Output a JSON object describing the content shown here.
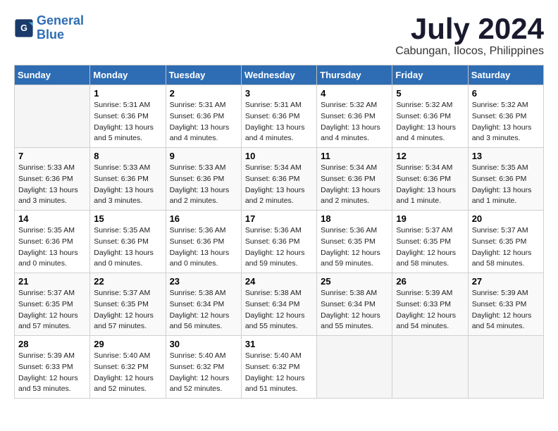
{
  "header": {
    "logo_line1": "General",
    "logo_line2": "Blue",
    "month_year": "July 2024",
    "location": "Cabungan, Ilocos, Philippines"
  },
  "weekdays": [
    "Sunday",
    "Monday",
    "Tuesday",
    "Wednesday",
    "Thursday",
    "Friday",
    "Saturday"
  ],
  "weeks": [
    [
      {
        "day": "",
        "info": ""
      },
      {
        "day": "1",
        "info": "Sunrise: 5:31 AM\nSunset: 6:36 PM\nDaylight: 13 hours\nand 5 minutes."
      },
      {
        "day": "2",
        "info": "Sunrise: 5:31 AM\nSunset: 6:36 PM\nDaylight: 13 hours\nand 4 minutes."
      },
      {
        "day": "3",
        "info": "Sunrise: 5:31 AM\nSunset: 6:36 PM\nDaylight: 13 hours\nand 4 minutes."
      },
      {
        "day": "4",
        "info": "Sunrise: 5:32 AM\nSunset: 6:36 PM\nDaylight: 13 hours\nand 4 minutes."
      },
      {
        "day": "5",
        "info": "Sunrise: 5:32 AM\nSunset: 6:36 PM\nDaylight: 13 hours\nand 4 minutes."
      },
      {
        "day": "6",
        "info": "Sunrise: 5:32 AM\nSunset: 6:36 PM\nDaylight: 13 hours\nand 3 minutes."
      }
    ],
    [
      {
        "day": "7",
        "info": "Sunrise: 5:33 AM\nSunset: 6:36 PM\nDaylight: 13 hours\nand 3 minutes."
      },
      {
        "day": "8",
        "info": "Sunrise: 5:33 AM\nSunset: 6:36 PM\nDaylight: 13 hours\nand 3 minutes."
      },
      {
        "day": "9",
        "info": "Sunrise: 5:33 AM\nSunset: 6:36 PM\nDaylight: 13 hours\nand 2 minutes."
      },
      {
        "day": "10",
        "info": "Sunrise: 5:34 AM\nSunset: 6:36 PM\nDaylight: 13 hours\nand 2 minutes."
      },
      {
        "day": "11",
        "info": "Sunrise: 5:34 AM\nSunset: 6:36 PM\nDaylight: 13 hours\nand 2 minutes."
      },
      {
        "day": "12",
        "info": "Sunrise: 5:34 AM\nSunset: 6:36 PM\nDaylight: 13 hours\nand 1 minute."
      },
      {
        "day": "13",
        "info": "Sunrise: 5:35 AM\nSunset: 6:36 PM\nDaylight: 13 hours\nand 1 minute."
      }
    ],
    [
      {
        "day": "14",
        "info": "Sunrise: 5:35 AM\nSunset: 6:36 PM\nDaylight: 13 hours\nand 0 minutes."
      },
      {
        "day": "15",
        "info": "Sunrise: 5:35 AM\nSunset: 6:36 PM\nDaylight: 13 hours\nand 0 minutes."
      },
      {
        "day": "16",
        "info": "Sunrise: 5:36 AM\nSunset: 6:36 PM\nDaylight: 13 hours\nand 0 minutes."
      },
      {
        "day": "17",
        "info": "Sunrise: 5:36 AM\nSunset: 6:36 PM\nDaylight: 12 hours\nand 59 minutes."
      },
      {
        "day": "18",
        "info": "Sunrise: 5:36 AM\nSunset: 6:35 PM\nDaylight: 12 hours\nand 59 minutes."
      },
      {
        "day": "19",
        "info": "Sunrise: 5:37 AM\nSunset: 6:35 PM\nDaylight: 12 hours\nand 58 minutes."
      },
      {
        "day": "20",
        "info": "Sunrise: 5:37 AM\nSunset: 6:35 PM\nDaylight: 12 hours\nand 58 minutes."
      }
    ],
    [
      {
        "day": "21",
        "info": "Sunrise: 5:37 AM\nSunset: 6:35 PM\nDaylight: 12 hours\nand 57 minutes."
      },
      {
        "day": "22",
        "info": "Sunrise: 5:37 AM\nSunset: 6:35 PM\nDaylight: 12 hours\nand 57 minutes."
      },
      {
        "day": "23",
        "info": "Sunrise: 5:38 AM\nSunset: 6:34 PM\nDaylight: 12 hours\nand 56 minutes."
      },
      {
        "day": "24",
        "info": "Sunrise: 5:38 AM\nSunset: 6:34 PM\nDaylight: 12 hours\nand 55 minutes."
      },
      {
        "day": "25",
        "info": "Sunrise: 5:38 AM\nSunset: 6:34 PM\nDaylight: 12 hours\nand 55 minutes."
      },
      {
        "day": "26",
        "info": "Sunrise: 5:39 AM\nSunset: 6:33 PM\nDaylight: 12 hours\nand 54 minutes."
      },
      {
        "day": "27",
        "info": "Sunrise: 5:39 AM\nSunset: 6:33 PM\nDaylight: 12 hours\nand 54 minutes."
      }
    ],
    [
      {
        "day": "28",
        "info": "Sunrise: 5:39 AM\nSunset: 6:33 PM\nDaylight: 12 hours\nand 53 minutes."
      },
      {
        "day": "29",
        "info": "Sunrise: 5:40 AM\nSunset: 6:32 PM\nDaylight: 12 hours\nand 52 minutes."
      },
      {
        "day": "30",
        "info": "Sunrise: 5:40 AM\nSunset: 6:32 PM\nDaylight: 12 hours\nand 52 minutes."
      },
      {
        "day": "31",
        "info": "Sunrise: 5:40 AM\nSunset: 6:32 PM\nDaylight: 12 hours\nand 51 minutes."
      },
      {
        "day": "",
        "info": ""
      },
      {
        "day": "",
        "info": ""
      },
      {
        "day": "",
        "info": ""
      }
    ]
  ]
}
